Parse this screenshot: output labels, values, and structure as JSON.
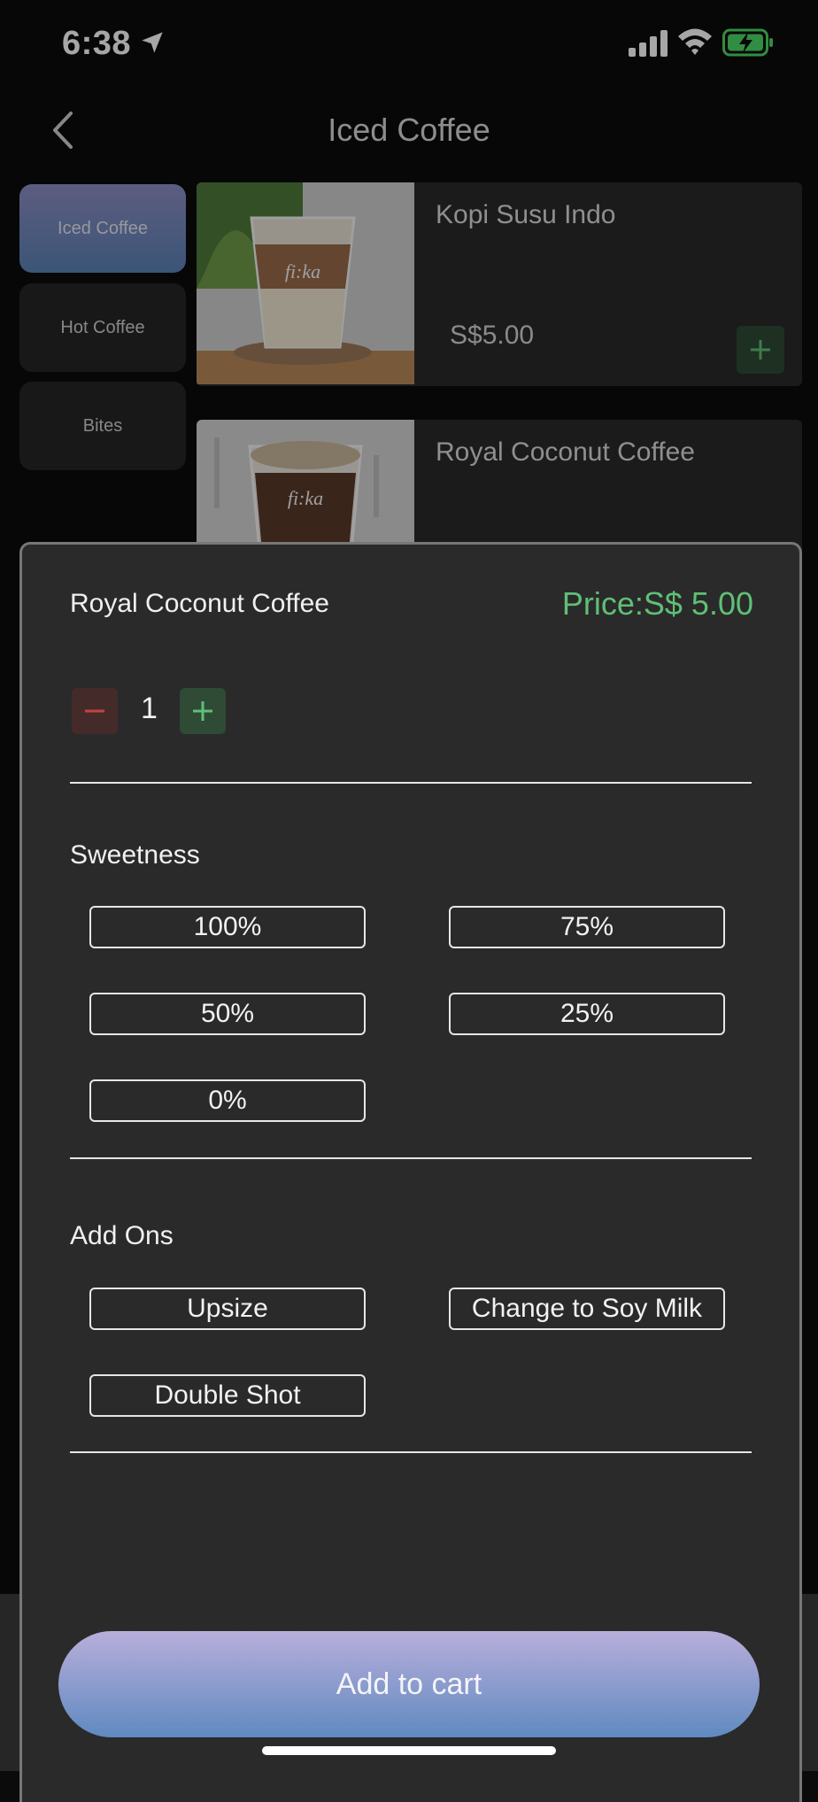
{
  "status_bar": {
    "time": "6:38",
    "icons": [
      "location-arrow-icon",
      "signal-icon",
      "wifi-icon",
      "battery-charging-icon"
    ]
  },
  "header": {
    "title": "Iced Coffee",
    "back_icon": "chevron-left-icon"
  },
  "categories": [
    {
      "label": "Iced Coffee",
      "active": true
    },
    {
      "label": "Hot Coffee",
      "active": false
    },
    {
      "label": "Bites",
      "active": false
    }
  ],
  "items": [
    {
      "name": "Kopi Susu Indo",
      "price": "S$5.00",
      "image_text": "fi:ka"
    },
    {
      "name": "Royal Coconut Coffee",
      "image_text": "fi:ka"
    }
  ],
  "sheet": {
    "product_name": "Royal Coconut Coffee",
    "price": "Price:S$ 5.00",
    "quantity": "1",
    "sweetness": {
      "title": "Sweetness",
      "options": [
        "100%",
        "75%",
        "50%",
        "25%",
        "0%"
      ]
    },
    "add_ons": {
      "title": "Add Ons",
      "options": [
        "Upsize",
        "Change to Soy Milk",
        "Double Shot"
      ]
    },
    "cart_button": "Add to cart"
  },
  "colors": {
    "accent_green": "#5fbf76",
    "minus_red": "#c0453d",
    "gradient_top": "#b9aedb",
    "gradient_bottom": "#5f8ac0"
  }
}
